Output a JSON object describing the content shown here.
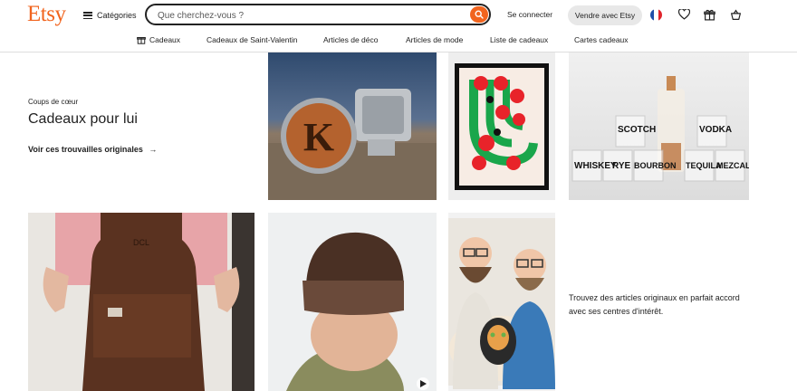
{
  "header": {
    "logo": "Etsy",
    "categories_label": "Catégories",
    "search_placeholder": "Que cherchez-vous ?",
    "signin_label": "Se connecter",
    "sell_label": "Vendre avec Etsy"
  },
  "nav": {
    "items": [
      "Cadeaux",
      "Cadeaux de Saint-Valentin",
      "Articles de déco",
      "Articles de mode",
      "Liste de cadeaux",
      "Cartes cadeaux"
    ]
  },
  "feature": {
    "eyebrow": "Coups de cœur",
    "title": "Cadeaux pour lui",
    "cta": "Voir ces trouvailles originales",
    "cta_arrow": "→"
  },
  "products": {
    "cufflink_letter": "K",
    "bottle_labels": [
      "SCOTCH",
      "VODKA",
      "WHISKEY",
      "RYE",
      "BOURBON",
      "TEQUILA",
      "MEZCAL"
    ],
    "apron_initials": "DCL"
  },
  "description": "Trouvez des articles originaux en parfait accord avec ses centres d'intérêt.",
  "colors": {
    "brand": "#f1641e",
    "text": "#222222",
    "pill": "#e8e8e8"
  }
}
